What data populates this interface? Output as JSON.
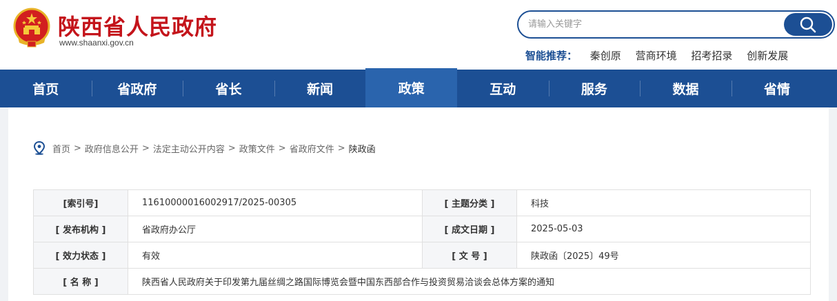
{
  "header": {
    "site_title": "陕西省人民政府",
    "site_url": "www.shaanxi.gov.cn",
    "search_placeholder": "请输入关键字",
    "hot_label": "智能推荐：",
    "hot_items": [
      "秦创原",
      "营商环境",
      "招考招录",
      "创新发展"
    ]
  },
  "nav": {
    "items": [
      "首页",
      "省政府",
      "省长",
      "新闻",
      "政策",
      "互动",
      "服务",
      "数据",
      "省情"
    ],
    "active": "政策"
  },
  "breadcrumb": {
    "items": [
      "首页",
      "政府信息公开",
      "法定主动公开内容",
      "政策文件",
      "省政府文件",
      "陕政函"
    ],
    "separator": ">"
  },
  "info": {
    "index_label": "[索引号]",
    "index_value": "11610000016002917/2025-00305",
    "topic_label": "[ 主题分类 ]",
    "topic_value": "科技",
    "issuer_label": "[ 发布机构 ]",
    "issuer_value": "省政府办公厅",
    "date_label": "[ 成文日期 ]",
    "date_value": "2025-05-03",
    "status_label": "[ 效力状态 ]",
    "status_value": "有效",
    "docno_label": "[ 文 号 ]",
    "docno_value": "陕政函〔2025〕49号",
    "name_label": "[ 名 称 ]",
    "name_value": "陕西省人民政府关于印发第九届丝绸之路国际博览会暨中国东西部合作与投资贸易洽谈会总体方案的通知"
  },
  "colors": {
    "brand_red": "#c4141b",
    "nav_blue": "#1c4f94",
    "nav_active": "#2a64ad"
  },
  "icons": [
    "national-emblem-icon",
    "search-icon",
    "location-pin-icon"
  ]
}
